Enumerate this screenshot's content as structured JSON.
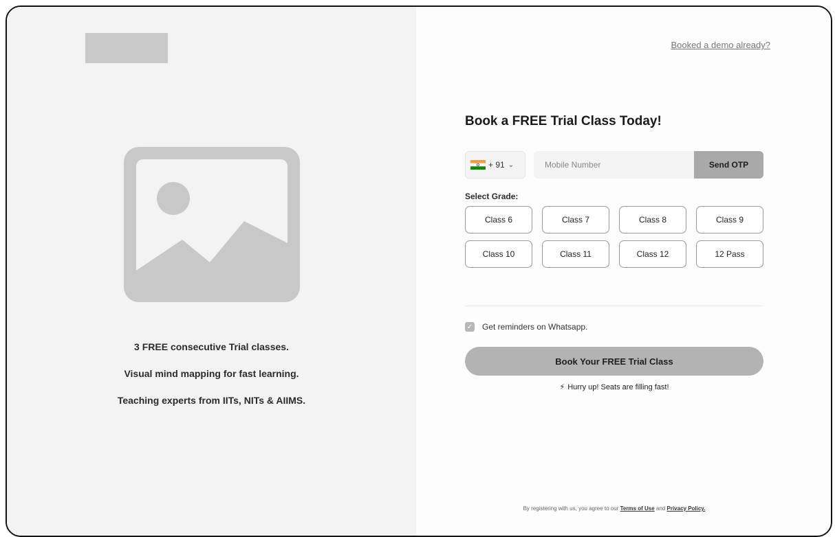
{
  "left_panel": {
    "logo_icon": "logo-placeholder",
    "hero_icon": "image-placeholder-icon",
    "features": [
      "3 FREE consecutive Trial classes.",
      "Visual mind mapping for fast learning.",
      "Teaching experts from IITs, NITs & AIIMS."
    ]
  },
  "right_panel": {
    "demo_link": "Booked a demo already?",
    "title": "Book a FREE Trial Class Today!",
    "country_code": "+ 91",
    "country_flag_icon": "india-flag-icon",
    "mobile_placeholder": "Mobile Number",
    "send_otp_label": "Send OTP",
    "grade_label": "Select Grade:",
    "grades": [
      "Class 6",
      "Class 7",
      "Class 8",
      "Class 9",
      "Class 10",
      "Class 11",
      "Class 12",
      "12 Pass"
    ],
    "reminder_label": "Get reminders on Whatsapp.",
    "reminder_checked": true,
    "book_button_label": "Book Your FREE Trial Class",
    "hurry_text": "Hurry up! Seats are filling fast!",
    "hurry_icon": "lightning-icon",
    "terms": {
      "prefix": "By registering with us, you agree to our",
      "terms_link": "Terms of Use",
      "and": "and",
      "privacy_link": "Privacy Policy."
    }
  },
  "colors": {
    "left_bg": "#f3f3f3",
    "placeholder_gray": "#c8c8c8",
    "button_gray": "#b3b3b3",
    "otp_gray": "#a9a9a9"
  }
}
